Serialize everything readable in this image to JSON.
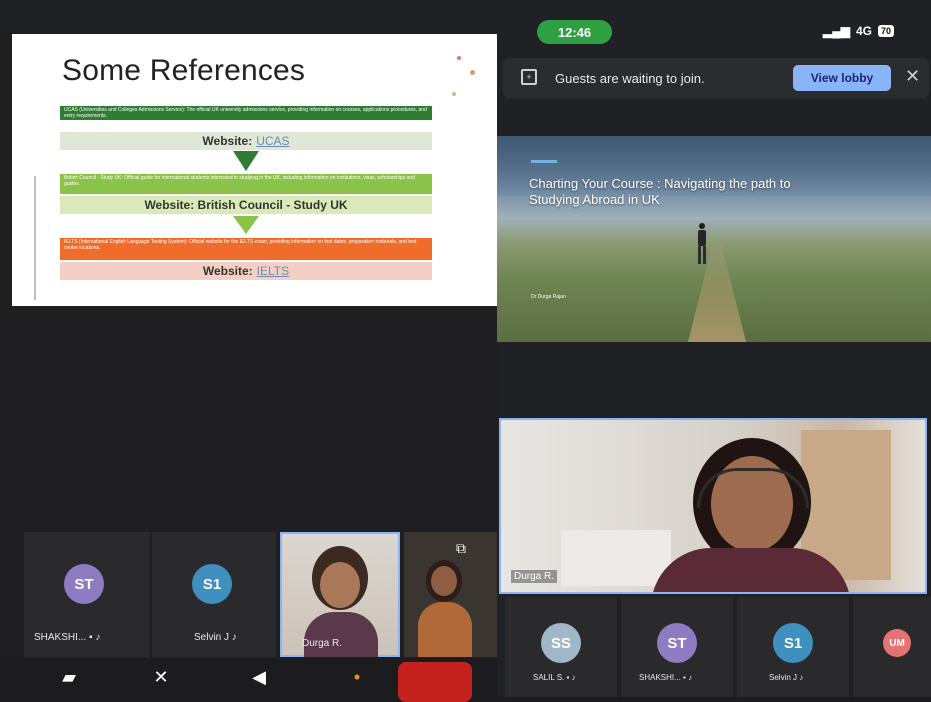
{
  "slide": {
    "title": "Some References",
    "refs": [
      {
        "header": "UCAS (Universities and Colleges Admissions Service): The official UK university admissions service, providing information on courses, applications procedures, and entry requirements.",
        "website_prefix": "Website:",
        "website_link": "UCAS",
        "header_color": "#2e7d32",
        "web_color": "#dfe8d8"
      },
      {
        "header": "British Council - Study UK: Official guide for international students interested in studying in the UK, including information on institutions, visas, scholarships and guides.",
        "website_prefix": "Website: British Council - Study UK",
        "website_link": "",
        "header_color": "#8bc34a",
        "web_color": "#dbe9b8"
      },
      {
        "header": "IELTS (International English Language Testing System): Official website for the IELTS exam, providing information on test dates, preparation materials, and test centre locations.",
        "website_prefix": "Website:",
        "website_link": "IELTS",
        "header_color": "#ef6c2a",
        "web_color": "#f5cfc4"
      }
    ]
  },
  "left_tiles": [
    {
      "initials": "ST",
      "name": "SHAKSHI...",
      "color": "#8e7cc3"
    },
    {
      "initials": "S1",
      "name": "Selvin J",
      "color": "#3f8fbf"
    }
  ],
  "left_video_tile": {
    "name": "Durga R."
  },
  "phone": {
    "time": "12:46",
    "signal": "4G",
    "battery": "70"
  },
  "banner": {
    "text": "Guests are waiting to join.",
    "button": "View lobby"
  },
  "presentation": {
    "title": "Charting Your Course : Navigating the path to Studying Abroad in UK",
    "author": "Dr Durga Rajan"
  },
  "speaker": {
    "name": "Durga R."
  },
  "right_tiles": [
    {
      "initials": "SS",
      "name": "SALIL S.",
      "color": "#9fb7c6"
    },
    {
      "initials": "ST",
      "name": "SHAKSHI...",
      "color": "#8e7cc3"
    },
    {
      "initials": "S1",
      "name": "Selvin J",
      "color": "#3f8fbf"
    },
    {
      "initials": "UM",
      "name": "",
      "color": "#e57373"
    }
  ]
}
